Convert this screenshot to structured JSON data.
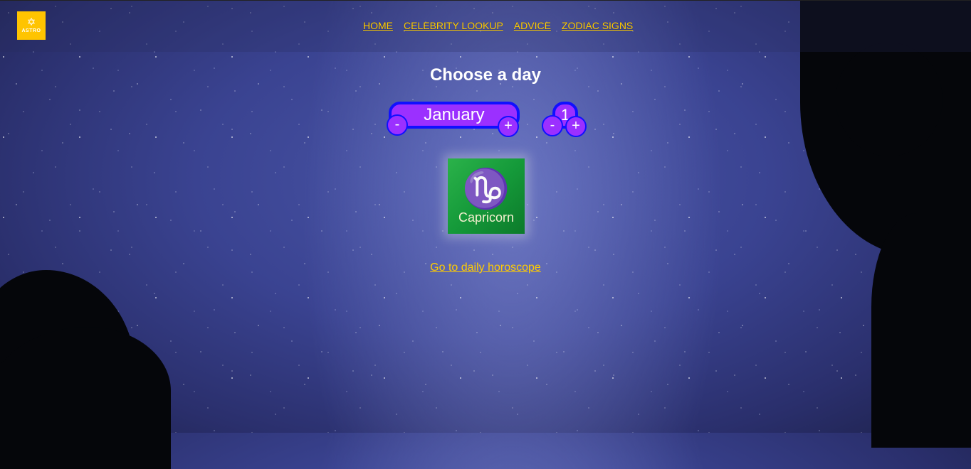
{
  "brand": {
    "logo_text": "ASTRO",
    "logo_color": "#ffc400"
  },
  "nav": {
    "items": [
      {
        "label": "HOME"
      },
      {
        "label": "CELEBRITY LOOKUP"
      },
      {
        "label": "ADVICE"
      },
      {
        "label": "ZODIAC SIGNS"
      }
    ]
  },
  "chooser": {
    "title": "Choose a day",
    "month_value": "January",
    "day_value": "1",
    "decrement_label": "-",
    "increment_label": "+"
  },
  "zodiac": {
    "glyph": "♑",
    "name": "Capricorn"
  },
  "link": {
    "label": "Go to daily horoscope"
  },
  "colors": {
    "accent": "#ffcc00",
    "button_fill": "#9b30ff",
    "button_border": "#1010ff"
  }
}
